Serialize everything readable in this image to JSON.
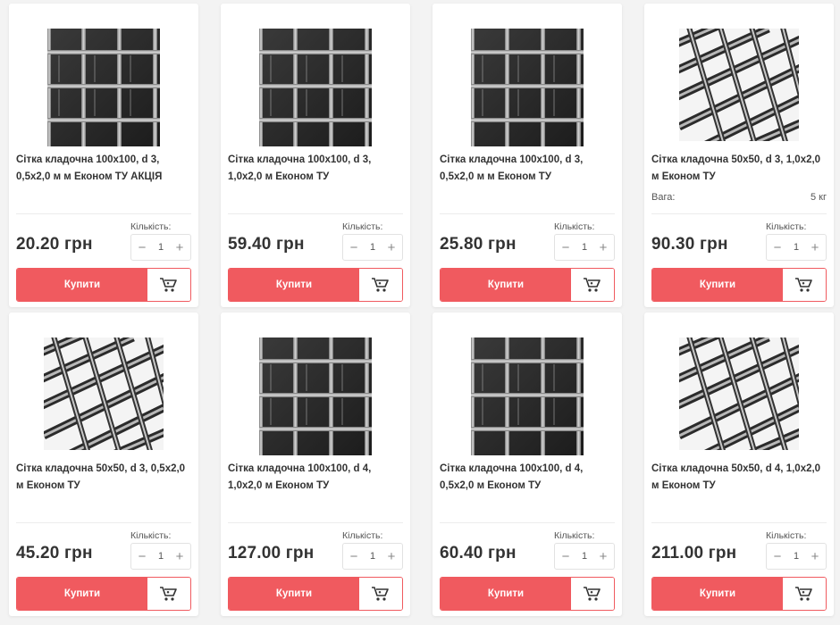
{
  "labels": {
    "quantity": "Кількість:",
    "buy": "Купити",
    "minus": "−",
    "plus": "+"
  },
  "colors": {
    "accent": "#f05a5f"
  },
  "products": [
    {
      "title": "Сітка кладочна 100х100, d 3, 0,5х2,0 м м Економ ТУ АКЦІЯ",
      "price": "20.20 грн",
      "qty": "1",
      "image": "mesh-100"
    },
    {
      "title": "Сітка кладочна 100х100, d 3, 1,0х2,0 м Економ ТУ",
      "price": "59.40 грн",
      "qty": "1",
      "image": "mesh-100"
    },
    {
      "title": "Сітка кладочна 100х100, d 3, 0,5х2,0 м м Економ ТУ",
      "price": "25.80 грн",
      "qty": "1",
      "image": "mesh-100"
    },
    {
      "title": "Сітка кладочна 50х50, d 3, 1,0х2,0 м Економ ТУ",
      "price": "90.30 грн",
      "qty": "1",
      "image": "mesh-50",
      "attr_label": "Вага:",
      "attr_value": "5 кг"
    },
    {
      "title": "Сітка кладочна 50х50, d 3, 0,5х2,0 м Економ ТУ",
      "price": "45.20 грн",
      "qty": "1",
      "image": "mesh-50"
    },
    {
      "title": "Сітка кладочна 100х100, d 4, 1,0х2,0 м Економ ТУ",
      "price": "127.00 грн",
      "qty": "1",
      "image": "mesh-100"
    },
    {
      "title": "Сітка кладочна 100х100, d 4, 0,5х2,0 м Економ ТУ",
      "price": "60.40 грн",
      "qty": "1",
      "image": "mesh-100"
    },
    {
      "title": "Сітка кладочна 50х50, d 4, 1,0х2,0 м Економ ТУ",
      "price": "211.00 грн",
      "qty": "1",
      "image": "mesh-50"
    }
  ]
}
